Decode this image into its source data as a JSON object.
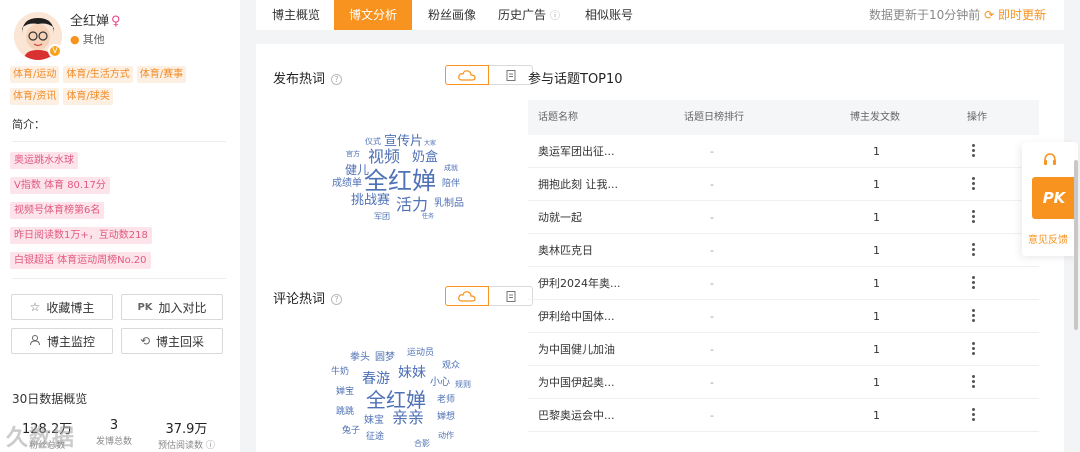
{
  "profile": {
    "name": "全红婵",
    "gender_symbol": "♀",
    "region": "其他",
    "tags": [
      "体育/运动",
      "体育/生活方式",
      "体育/赛事",
      "体育/资讯",
      "体育/球类"
    ],
    "intro_label": "简介：",
    "highlights": [
      "奥运跳水水球",
      "V指数 体育 80.17分",
      "视频号体育榜第6名",
      "昨日阅读数1万+，互动数218",
      "白银超话 体育运动周榜No.20"
    ],
    "buttons": {
      "favorite": "收藏博主",
      "compare": "加入对比",
      "compare_icon_text": "PK",
      "monitor": "博主监控",
      "review": "博主回采"
    },
    "stats_title": "30日数据概览",
    "stats": [
      {
        "value": "128.2万",
        "label": "粉丝总数"
      },
      {
        "value": "3",
        "label": "发博总数"
      },
      {
        "value": "37.9万",
        "label": "预估阅读数"
      }
    ],
    "watermark": "久数据"
  },
  "tabs": [
    {
      "label": "博主概览",
      "active": false
    },
    {
      "label": "博文分析",
      "active": true
    },
    {
      "label": "粉丝画像",
      "active": false
    },
    {
      "label": "历史广告",
      "active": false
    },
    {
      "label": "相似账号",
      "active": false
    }
  ],
  "update": {
    "text": "数据更新于10分钟前",
    "refresh_label": "即时更新"
  },
  "publish_words": {
    "title": "发布热词",
    "words": [
      "仪式",
      "宣传片",
      "大家",
      "官方",
      "视频",
      "奶盒",
      "健儿",
      "成就",
      "成绩单",
      "全红婵",
      "陪伴",
      "挑战赛",
      "活力",
      "乳制品",
      "军团",
      "任务"
    ]
  },
  "comment_words": {
    "title": "评论热词",
    "words": [
      "拳头",
      "圆梦",
      "运动员",
      "牛奶",
      "春游",
      "妹妹",
      "观众",
      "婵宝",
      "小心",
      "规则",
      "全红婵",
      "老师",
      "跳跳",
      "妹宝",
      "亲亲",
      "婵想",
      "兔子",
      "征途",
      "动作",
      "合影"
    ]
  },
  "topics": {
    "title": "参与话题TOP10",
    "columns": [
      "话题名称",
      "话题日榜排行",
      "博主发文数",
      "操作"
    ],
    "rows": [
      {
        "name": "奥运军团出征...",
        "rank": "-",
        "count": "1"
      },
      {
        "name": "拥抱此刻 让我...",
        "rank": "-",
        "count": "1"
      },
      {
        "name": "动就一起",
        "rank": "-",
        "count": "1"
      },
      {
        "name": "奥林匹克日",
        "rank": "-",
        "count": "1"
      },
      {
        "name": "伊利2024年奥...",
        "rank": "-",
        "count": "1"
      },
      {
        "name": "伊利给中国体...",
        "rank": "-",
        "count": "1"
      },
      {
        "name": "为中国健儿加油",
        "rank": "-",
        "count": "1"
      },
      {
        "name": "为中国伊起奥...",
        "rank": "-",
        "count": "1"
      },
      {
        "name": "巴黎奥运会中...",
        "rank": "-",
        "count": "1"
      }
    ]
  },
  "float_widget": {
    "pk_label": "PK",
    "feedback_label": "意见反馈"
  },
  "colors": {
    "accent": "#f7931e",
    "word": "#4f71b5",
    "tag_bg": "#fdf0e2",
    "pink_bg": "#fde3ea"
  }
}
